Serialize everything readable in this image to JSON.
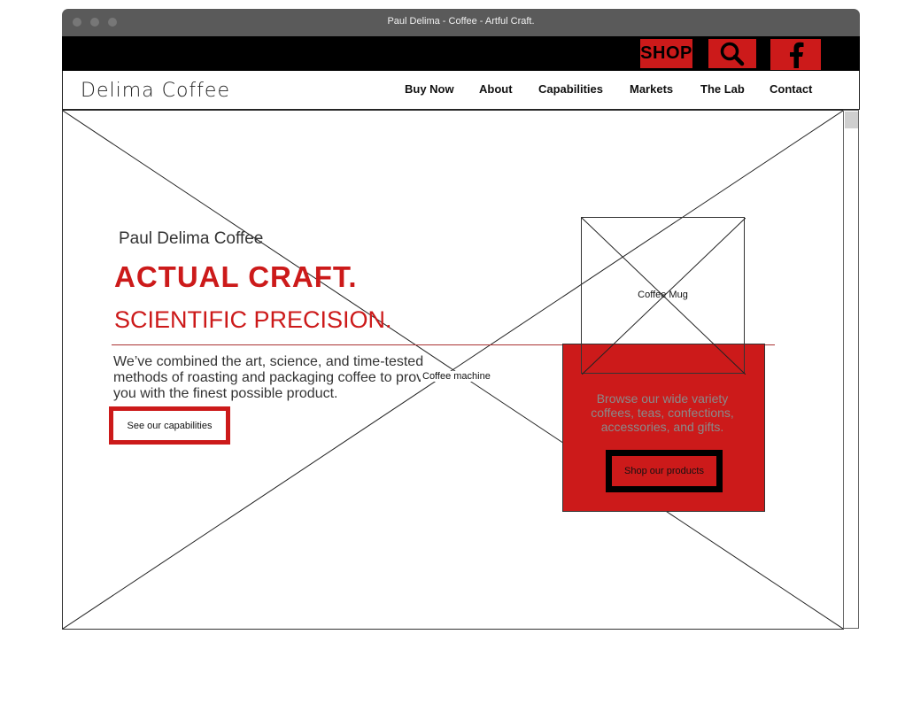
{
  "window": {
    "title": "Paul Delima - Coffee - Artful Craft."
  },
  "topbar": {
    "shop_label": "SHOP",
    "search_icon": "search-icon",
    "facebook_icon": "facebook-icon"
  },
  "nav": {
    "logo": "Delima Coffee",
    "items": [
      {
        "label": "Buy Now"
      },
      {
        "label": "About"
      },
      {
        "label": "Capabilities"
      },
      {
        "label": "Markets"
      },
      {
        "label": "The Lab"
      },
      {
        "label": "Contact"
      }
    ]
  },
  "hero": {
    "subtitle": "Paul Delima Coffee",
    "headline": "ACTUAL CRAFT.",
    "headline2": "SCIENTIFIC PRECISION.",
    "body": "We’ve combined the art, science, and time-tested methods of roasting and packaging coffee to provide you with the finest possible product.",
    "cta_label": "See our capabilities",
    "image_label": "Coffee machine"
  },
  "promo": {
    "image_label": "Coffee Mug",
    "text": "Browse our wide variety coffees, teas, confections, accessories, and gifts.",
    "button_label": "Shop our products"
  },
  "colors": {
    "accent": "#cc1a1a",
    "topbar": "#000000",
    "titlebar": "#5a5a5a"
  }
}
